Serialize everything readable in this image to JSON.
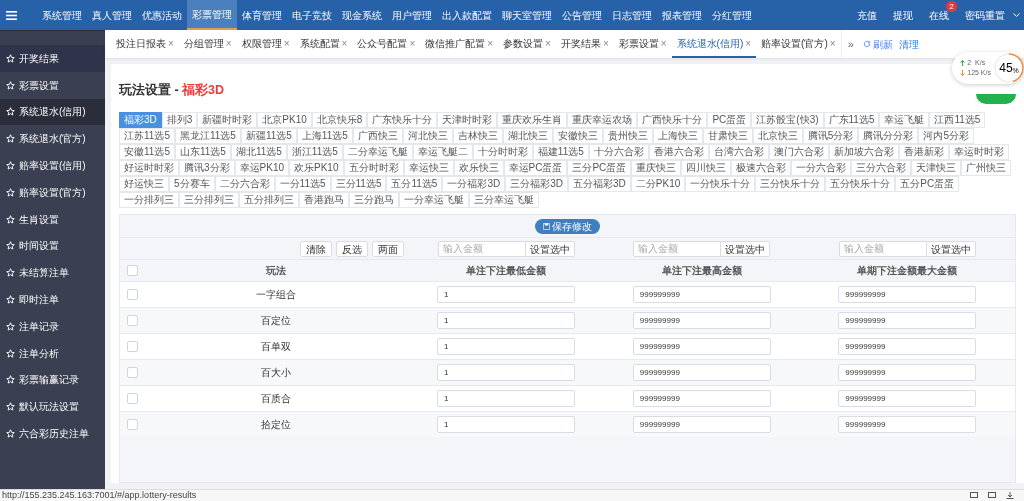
{
  "top_nav": {
    "items": [
      {
        "label": "系统管理",
        "selected": false
      },
      {
        "label": "真人管理",
        "selected": false
      },
      {
        "label": "优惠活动",
        "selected": false
      },
      {
        "label": "彩票管理",
        "selected": true
      },
      {
        "label": "体育管理",
        "selected": false
      },
      {
        "label": "电子竞技",
        "selected": false
      },
      {
        "label": "现金系统",
        "selected": false
      },
      {
        "label": "用户管理",
        "selected": false
      },
      {
        "label": "出入款配置",
        "selected": false
      },
      {
        "label": "聊天室管理",
        "selected": false
      },
      {
        "label": "公告管理",
        "selected": false
      },
      {
        "label": "日志管理",
        "selected": false
      },
      {
        "label": "报表管理",
        "selected": false
      },
      {
        "label": "分红管理",
        "selected": false
      }
    ],
    "right": [
      {
        "label": "充值"
      },
      {
        "label": "提现"
      },
      {
        "label": "在线",
        "badge": "2"
      },
      {
        "label": "密码重置"
      }
    ]
  },
  "sidebar": {
    "items": [
      {
        "label": "开奖结果",
        "selected": false
      },
      {
        "label": "彩票设置",
        "selected": false
      },
      {
        "label": "系统退水(信用)",
        "selected": true
      },
      {
        "label": "系统退水(官方)",
        "selected": false
      },
      {
        "label": "赔率设置(信用)",
        "selected": false
      },
      {
        "label": "赔率设置(官方)",
        "selected": false
      },
      {
        "label": "生肖设置",
        "selected": false
      },
      {
        "label": "时间设置",
        "selected": false
      },
      {
        "label": "未结算注单",
        "selected": false
      },
      {
        "label": "即时注单",
        "selected": false
      },
      {
        "label": "注单记录",
        "selected": false
      },
      {
        "label": "注单分析",
        "selected": false
      },
      {
        "label": "彩票输赢记录",
        "selected": false
      },
      {
        "label": "默认玩法设置",
        "selected": false
      },
      {
        "label": "六合彩历史注单",
        "selected": false
      }
    ]
  },
  "tabs": [
    {
      "label": "投注日报表",
      "close": "×",
      "selected": false
    },
    {
      "label": "分组管理",
      "close": "×",
      "selected": false
    },
    {
      "label": "权限管理",
      "close": "×",
      "selected": false
    },
    {
      "label": "系统配置",
      "close": "×",
      "selected": false
    },
    {
      "label": "公众号配置",
      "close": "×",
      "selected": false
    },
    {
      "label": "微信推广配置",
      "close": "×",
      "selected": false
    },
    {
      "label": "参数设置",
      "close": "×",
      "selected": false
    },
    {
      "label": "开奖结果",
      "close": "×",
      "selected": false
    },
    {
      "label": "彩票设置",
      "close": "×",
      "selected": false
    },
    {
      "label": "系统退水(信用)",
      "close": "×",
      "selected": true
    },
    {
      "label": "赔率设置(官方)",
      "close": "×",
      "selected": false
    }
  ],
  "tab_tools": {
    "more": "»",
    "refresh": "刷新",
    "clear": "清理"
  },
  "network": {
    "up": "2  K/s",
    "down": "125 K/s",
    "percent": "45",
    "unit": "%"
  },
  "page_title": {
    "prefix": "玩法设置 - ",
    "name": "福彩3D"
  },
  "lottery_types": [
    {
      "label": "福彩3D",
      "selected": true
    },
    {
      "label": "排列3",
      "selected": false
    },
    {
      "label": "新疆时时彩",
      "selected": false
    },
    {
      "label": "北京PK10",
      "selected": false
    },
    {
      "label": "北京快乐8",
      "selected": false
    },
    {
      "label": "广东快乐十分",
      "selected": false
    },
    {
      "label": "天津时时彩",
      "selected": false
    },
    {
      "label": "重庆欢乐生肖",
      "selected": false
    },
    {
      "label": "重庆幸运农场",
      "selected": false
    },
    {
      "label": "广西快乐十分",
      "selected": false
    },
    {
      "label": "PC蛋蛋",
      "selected": false
    },
    {
      "label": "江苏骰宝(快3)",
      "selected": false
    },
    {
      "label": "广东11选5",
      "selected": false
    },
    {
      "label": "幸运飞艇",
      "selected": false
    },
    {
      "label": "江西11选5",
      "selected": false
    },
    {
      "label": "江苏11选5",
      "selected": false
    },
    {
      "label": "黑龙江11选5",
      "selected": false
    },
    {
      "label": "新疆11选5",
      "selected": false
    },
    {
      "label": "上海11选5",
      "selected": false
    },
    {
      "label": "广西快三",
      "selected": false
    },
    {
      "label": "河北快三",
      "selected": false
    },
    {
      "label": "吉林快三",
      "selected": false
    },
    {
      "label": "湖北快三",
      "selected": false
    },
    {
      "label": "安徽快三",
      "selected": false
    },
    {
      "label": "贵州快三",
      "selected": false
    },
    {
      "label": "上海快三",
      "selected": false
    },
    {
      "label": "甘肃快三",
      "selected": false
    },
    {
      "label": "北京快三",
      "selected": false
    },
    {
      "label": "腾讯5分彩",
      "selected": false
    },
    {
      "label": "腾讯分分彩",
      "selected": false
    },
    {
      "label": "河内5分彩",
      "selected": false
    },
    {
      "label": "安徽11选5",
      "selected": false
    },
    {
      "label": "山东11选5",
      "selected": false
    },
    {
      "label": "湖北11选5",
      "selected": false
    },
    {
      "label": "浙江11选5",
      "selected": false
    },
    {
      "label": "二分幸运飞艇",
      "selected": false
    },
    {
      "label": "幸运飞艇二",
      "selected": false
    },
    {
      "label": "十分时时彩",
      "selected": false
    },
    {
      "label": "福建11选5",
      "selected": false
    },
    {
      "label": "十分六合彩",
      "selected": false
    },
    {
      "label": "香港六合彩",
      "selected": false
    },
    {
      "label": "台湾六合彩",
      "selected": false
    },
    {
      "label": "澳门六合彩",
      "selected": false
    },
    {
      "label": "新加坡六合彩",
      "selected": false
    },
    {
      "label": "香港新彩",
      "selected": false
    },
    {
      "label": "幸运时时彩",
      "selected": false
    },
    {
      "label": "好运时时彩",
      "selected": false
    },
    {
      "label": "腾讯3分彩",
      "selected": false
    },
    {
      "label": "幸运PK10",
      "selected": false
    },
    {
      "label": "欢乐PK10",
      "selected": false
    },
    {
      "label": "五分时时彩",
      "selected": false
    },
    {
      "label": "幸运快三",
      "selected": false
    },
    {
      "label": "欢乐快三",
      "selected": false
    },
    {
      "label": "幸运PC蛋蛋",
      "selected": false
    },
    {
      "label": "三分PC蛋蛋",
      "selected": false
    },
    {
      "label": "重庆快三",
      "selected": false
    },
    {
      "label": "四川快三",
      "selected": false
    },
    {
      "label": "极速六合彩",
      "selected": false
    },
    {
      "label": "一分六合彩",
      "selected": false
    },
    {
      "label": "三分六合彩",
      "selected": false
    },
    {
      "label": "天津快三",
      "selected": false
    },
    {
      "label": "广州快三",
      "selected": false
    },
    {
      "label": "好运快三",
      "selected": false
    },
    {
      "label": "5分赛车",
      "selected": false
    },
    {
      "label": "二分六合彩",
      "selected": false
    },
    {
      "label": "一分11选5",
      "selected": false
    },
    {
      "label": "三分11选5",
      "selected": false
    },
    {
      "label": "五分11选5",
      "selected": false
    },
    {
      "label": "一分福彩3D",
      "selected": false
    },
    {
      "label": "三分福彩3D",
      "selected": false
    },
    {
      "label": "五分福彩3D",
      "selected": false
    },
    {
      "label": "二分PK10",
      "selected": false
    },
    {
      "label": "一分快乐十分",
      "selected": false
    },
    {
      "label": "三分快乐十分",
      "selected": false
    },
    {
      "label": "五分快乐十分",
      "selected": false
    },
    {
      "label": "五分PC蛋蛋",
      "selected": false
    },
    {
      "label": "一分排列三",
      "selected": false
    },
    {
      "label": "三分排列三",
      "selected": false
    },
    {
      "label": "五分排列三",
      "selected": false
    },
    {
      "label": "香港跑马",
      "selected": false
    },
    {
      "label": "三分跑马",
      "selected": false
    },
    {
      "label": "一分幸运飞艇",
      "selected": false
    },
    {
      "label": "三分幸运飞艇",
      "selected": false
    }
  ],
  "save_button": "保存修改",
  "bulk_buttons": [
    "清除",
    "反选",
    "两面"
  ],
  "amount_setters": [
    {
      "placeholder": "输入金额",
      "button": "设置选中"
    },
    {
      "placeholder": "输入金额",
      "button": "设置选中"
    },
    {
      "placeholder": "输入金额",
      "button": "设置选中"
    }
  ],
  "table": {
    "columns": [
      "玩法",
      "单注下注最低金额",
      "单注下注最高金额",
      "单期下注金额最大金额"
    ],
    "header_checked": false,
    "rows": [
      {
        "name": "一字组合",
        "min": "1",
        "max": "999999999",
        "period_max": "999999999",
        "checked": false
      },
      {
        "name": "百定位",
        "min": "1",
        "max": "999999999",
        "period_max": "999999999",
        "checked": false
      },
      {
        "name": "百单双",
        "min": "1",
        "max": "999999999",
        "period_max": "999999999",
        "checked": false
      },
      {
        "name": "百大小",
        "min": "1",
        "max": "999999999",
        "period_max": "999999999",
        "checked": false
      },
      {
        "name": "百质合",
        "min": "1",
        "max": "999999999",
        "period_max": "999999999",
        "checked": false
      },
      {
        "name": "拾定位",
        "min": "1",
        "max": "999999999",
        "period_max": "999999999",
        "checked": false
      }
    ]
  },
  "status_bar": {
    "url": "http://155.235.245.163:7001/#/app.lottery-results"
  }
}
